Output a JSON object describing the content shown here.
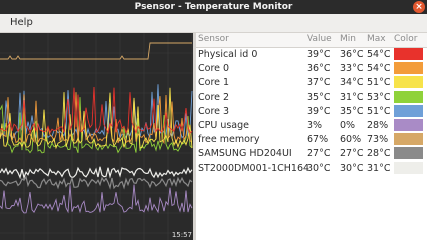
{
  "window": {
    "title": "Psensor - Temperature Monitor",
    "close_symbol": "×"
  },
  "menu": {
    "help_label": "Help"
  },
  "graph": {
    "time_label": "15:57"
  },
  "table": {
    "headers": {
      "sensor": "Sensor",
      "value": "Value",
      "min": "Min",
      "max": "Max",
      "color": "Color"
    },
    "rows": [
      {
        "sensor": "Physical id 0",
        "value": "39°C",
        "min": "36°C",
        "max": "54°C",
        "color": "#e8322c"
      },
      {
        "sensor": "Core 0",
        "value": "36°C",
        "min": "33°C",
        "max": "54°C",
        "color": "#f39c3a"
      },
      {
        "sensor": "Core 1",
        "value": "37°C",
        "min": "34°C",
        "max": "51°C",
        "color": "#f7e34a"
      },
      {
        "sensor": "Core 2",
        "value": "35°C",
        "min": "31°C",
        "max": "53°C",
        "color": "#8fd23a"
      },
      {
        "sensor": "Core 3",
        "value": "39°C",
        "min": "35°C",
        "max": "51°C",
        "color": "#6fa0d8"
      },
      {
        "sensor": "CPU usage",
        "value": "3%",
        "min": "0%",
        "max": "28%",
        "color": "#a98bc6"
      },
      {
        "sensor": "free memory",
        "value": "67%",
        "min": "60%",
        "max": "73%",
        "color": "#d6a867"
      },
      {
        "sensor": "SAMSUNG HD204UI",
        "value": "27°C",
        "min": "27°C",
        "max": "28°C",
        "color": "#8a8a8a"
      },
      {
        "sensor": "ST2000DM001-1CH164",
        "value": "30°C",
        "min": "30°C",
        "max": "31°C",
        "color": "#eeeeea"
      }
    ]
  }
}
